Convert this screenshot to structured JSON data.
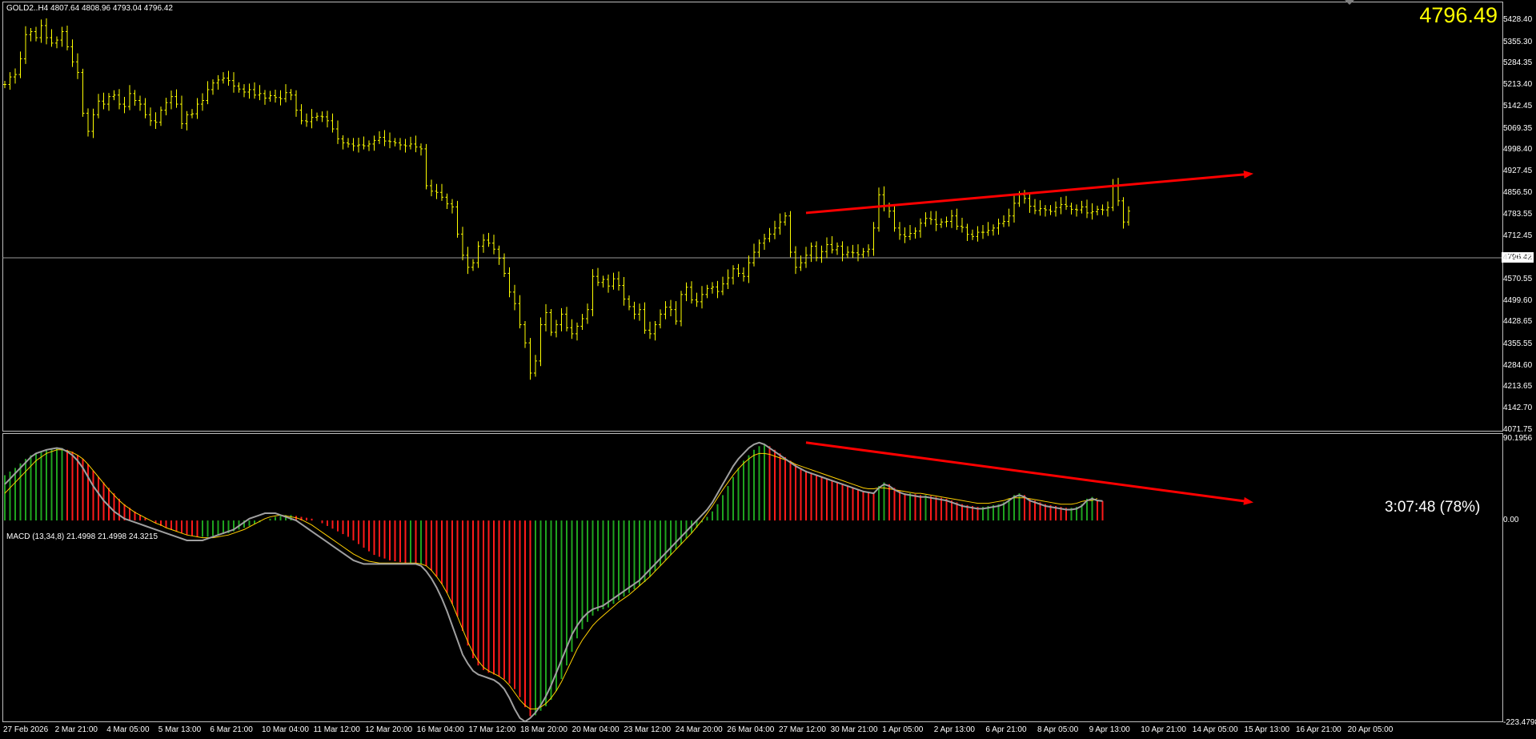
{
  "window": {
    "symbol_line": "GOLD2..H4  4807.64 4808.96 4793.04 4796.42",
    "bid_display": "4796.49",
    "current_price_box": "4796.42",
    "countdown": "3:07:48 (78%)"
  },
  "colors": {
    "background": "#000000",
    "candle": "#ffff00",
    "trendline": "#ff0000",
    "histogram_up": "#1fa41f",
    "histogram_down": "#ff1a1a",
    "macd_line": "#a0a0a0",
    "signal_line": "#ffd000"
  },
  "chart_data": [
    {
      "type": "bar",
      "title": "GOLD2..H4",
      "ylim": [
        4071.75,
        5470
      ],
      "y_ticks": [
        "5428.40",
        "5355.30",
        "5284.35",
        "5213.40",
        "5142.45",
        "5069.35",
        "4998.40",
        "4927.45",
        "4856.50",
        "4783.55",
        "4712.45",
        "4641.50",
        "4570.55",
        "4499.60",
        "4428.65",
        "4355.55",
        "4284.60",
        "4213.65",
        "4142.70",
        "4071.75"
      ],
      "x_tick_labels": [
        "27 Feb 2026",
        "2 Mar 21:00",
        "4 Mar 05:00",
        "5 Mar 13:00",
        "6 Mar 21:00",
        "10 Mar 04:00",
        "11 Mar 12:00",
        "12 Mar 20:00",
        "16 Mar 04:00",
        "17 Mar 12:00",
        "18 Mar 20:00",
        "20 Mar 04:00",
        "23 Mar 12:00",
        "24 Mar 20:00",
        "26 Mar 04:00",
        "27 Mar 12:00",
        "30 Mar 21:00",
        "1 Apr 05:00",
        "2 Apr 13:00",
        "6 Apr 21:00",
        "8 Apr 05:00",
        "9 Apr 13:00",
        "10 Apr 21:00",
        "14 Apr 05:00",
        "15 Apr 13:00",
        "16 Apr 21:00",
        "20 Apr 05:00"
      ],
      "series": [
        {
          "close": [
            5215,
            5240,
            5248,
            5300,
            5380,
            5390,
            5370,
            5410,
            5370,
            5352,
            5362,
            5390,
            5340,
            5290,
            5255,
            5120,
            5060,
            5115,
            5160,
            5150,
            5175,
            5180,
            5150,
            5142,
            5185,
            5162,
            5150,
            5115,
            5095,
            5090,
            5130,
            5155,
            5175,
            5150,
            5085,
            5115,
            5118,
            5150,
            5162,
            5198,
            5220,
            5230,
            5236,
            5228,
            5210,
            5200,
            5190,
            5198,
            5180,
            5185,
            5170,
            5178,
            5172,
            5168,
            5188,
            5180,
            5130,
            5095,
            5092,
            5106,
            5110,
            5108,
            5095,
            5068,
            5035,
            5022,
            5018,
            5012,
            5015,
            5012,
            5018,
            5030,
            5040,
            5028,
            5026,
            5022,
            5015,
            5012,
            5018,
            5008,
            5002,
            4880,
            4862,
            4858,
            4842,
            4820,
            4810,
            4720,
            4650,
            4610,
            4625,
            4680,
            4700,
            4690,
            4670,
            4640,
            4590,
            4528,
            4490,
            4420,
            4360,
            4260,
            4300,
            4420,
            4460,
            4395,
            4420,
            4455,
            4410,
            4390,
            4415,
            4440,
            4470,
            4580,
            4560,
            4570,
            4548,
            4572,
            4550,
            4505,
            4480,
            4455,
            4470,
            4402,
            4390,
            4420,
            4455,
            4478,
            4470,
            4432,
            4520,
            4544,
            4502,
            4496,
            4520,
            4540,
            4545,
            4530,
            4555,
            4575,
            4605,
            4590,
            4580,
            4625,
            4660,
            4690,
            4705,
            4720,
            4740,
            4760,
            4780,
            4660,
            4610,
            4625,
            4650,
            4680,
            4642,
            4662,
            4685,
            4668,
            4680,
            4652,
            4660,
            4658,
            4652,
            4662,
            4670,
            4740,
            4850,
            4812,
            4796,
            4740,
            4718,
            4712,
            4722,
            4730,
            4756,
            4772,
            4768,
            4752,
            4760,
            4762,
            4780,
            4746,
            4742,
            4719,
            4712,
            4726,
            4726,
            4732,
            4740,
            4755,
            4762,
            4780,
            4822,
            4850,
            4838,
            4812,
            4798,
            4804,
            4800,
            4795,
            4808,
            4818,
            4812,
            4802,
            4800,
            4810,
            4790,
            4794,
            4802,
            4800,
            4808,
            4878,
            4830,
            4760,
            4796
          ]
        }
      ]
    },
    {
      "type": "bar",
      "title": "MACD (13,34,8) 21.4998 21.4998 24.3215",
      "ylim": [
        -223.4798,
        90.1956
      ],
      "y_ticks": [
        "90.1956",
        "0.00",
        "-223.4798"
      ],
      "series": [
        {
          "name": "histogram",
          "values": [
            50,
            54,
            58,
            63,
            68,
            72,
            74,
            76,
            78,
            79,
            80,
            80,
            78,
            76,
            72,
            68,
            62,
            55,
            48,
            42,
            36,
            30,
            24,
            18,
            14,
            10,
            6,
            3,
            0,
            -3,
            -6,
            -8,
            -10,
            -12,
            -14,
            -16,
            -17,
            -18,
            -18,
            -18,
            -17,
            -16,
            -15,
            -14,
            -12,
            -10,
            -8,
            -6,
            -4,
            -2,
            0,
            2,
            4,
            5,
            6,
            6,
            5,
            4,
            3,
            2,
            0,
            -3,
            -6,
            -9,
            -12,
            -15,
            -18,
            -22,
            -26,
            -30,
            -34,
            -38,
            -40,
            -42,
            -44,
            -45,
            -46,
            -47,
            -47,
            -48,
            -48,
            -50,
            -55,
            -62,
            -70,
            -80,
            -92,
            -106,
            -122,
            -138,
            -152,
            -160,
            -165,
            -168,
            -170,
            -172,
            -175,
            -180,
            -186,
            -195,
            -206,
            -216,
            -215,
            -210,
            -205,
            -198,
            -188,
            -175,
            -160,
            -145,
            -130,
            -120,
            -112,
            -105,
            -100,
            -98,
            -96,
            -92,
            -88,
            -84,
            -80,
            -76,
            -72,
            -68,
            -62,
            -56,
            -50,
            -44,
            -38,
            -32,
            -26,
            -20,
            -14,
            -8,
            -2,
            4,
            10,
            18,
            28,
            38,
            48,
            58,
            66,
            72,
            78,
            82,
            84,
            82,
            78,
            74,
            70,
            66,
            62,
            58,
            55,
            52,
            50,
            48,
            46,
            44,
            42,
            40,
            38,
            36,
            34,
            32,
            31,
            30,
            38,
            42,
            40,
            36,
            33,
            30,
            30,
            29,
            28,
            28,
            27,
            26,
            25,
            24,
            22,
            20,
            18,
            17,
            16,
            15,
            15,
            16,
            17,
            18,
            20,
            24,
            28,
            30,
            28,
            24,
            22,
            20,
            18,
            17,
            16,
            15,
            14,
            14,
            15,
            18,
            24,
            26,
            22,
            21.4998
          ]
        },
        {
          "name": "macd",
          "values": [
            40,
            46,
            52,
            58,
            64,
            70,
            74,
            76,
            78,
            79,
            80,
            79,
            76,
            72,
            66,
            58,
            48,
            38,
            30,
            22,
            16,
            10,
            6,
            2,
            0,
            -2,
            -4,
            -6,
            -8,
            -10,
            -12,
            -14,
            -16,
            -18,
            -20,
            -22,
            -22,
            -22,
            -22,
            -20,
            -18,
            -16,
            -14,
            -12,
            -10,
            -6,
            -2,
            2,
            4,
            6,
            8,
            8,
            8,
            6,
            4,
            2,
            0,
            -4,
            -8,
            -12,
            -16,
            -20,
            -24,
            -28,
            -32,
            -36,
            -40,
            -44,
            -46,
            -48,
            -48,
            -48,
            -48,
            -48,
            -48,
            -48,
            -48,
            -48,
            -48,
            -48,
            -50,
            -56,
            -64,
            -74,
            -86,
            -100,
            -116,
            -132,
            -148,
            -158,
            -166,
            -170,
            -172,
            -174,
            -176,
            -180,
            -186,
            -196,
            -208,
            -218,
            -222,
            -218,
            -212,
            -204,
            -194,
            -182,
            -168,
            -154,
            -140,
            -126,
            -116,
            -108,
            -102,
            -98,
            -96,
            -94,
            -90,
            -86,
            -82,
            -78,
            -74,
            -70,
            -66,
            -60,
            -54,
            -48,
            -42,
            -36,
            -30,
            -24,
            -18,
            -12,
            -6,
            0,
            6,
            12,
            20,
            30,
            40,
            50,
            60,
            68,
            74,
            80,
            84,
            86,
            84,
            80,
            76,
            72,
            68,
            64,
            60,
            57,
            54,
            52,
            50,
            48,
            46,
            44,
            42,
            40,
            38,
            36,
            34,
            32,
            31,
            30,
            36,
            40,
            38,
            34,
            31,
            29,
            28,
            27,
            26,
            26,
            25,
            24,
            23,
            22,
            20,
            18,
            16,
            15,
            14,
            13,
            13,
            14,
            15,
            16,
            18,
            22,
            26,
            28,
            26,
            22,
            20,
            18,
            16,
            15,
            14,
            13,
            12,
            12,
            13,
            16,
            22,
            24,
            22,
            21.4998
          ]
        },
        {
          "name": "signal",
          "values": [
            30,
            36,
            42,
            48,
            54,
            60,
            66,
            70,
            74,
            76,
            78,
            78,
            77,
            75,
            72,
            68,
            62,
            55,
            48,
            41,
            34,
            28,
            22,
            17,
            13,
            9,
            6,
            3,
            0,
            -3,
            -5,
            -8,
            -10,
            -12,
            -14,
            -16,
            -17,
            -18,
            -19,
            -19,
            -19,
            -18,
            -17,
            -16,
            -14,
            -12,
            -10,
            -7,
            -4,
            -1,
            2,
            4,
            5,
            6,
            5,
            4,
            3,
            1,
            -2,
            -5,
            -9,
            -13,
            -17,
            -21,
            -25,
            -29,
            -33,
            -37,
            -40,
            -43,
            -45,
            -46,
            -47,
            -47,
            -47,
            -47,
            -47,
            -47,
            -47,
            -47,
            -48,
            -50,
            -55,
            -62,
            -70,
            -80,
            -92,
            -106,
            -120,
            -134,
            -146,
            -155,
            -162,
            -166,
            -169,
            -172,
            -176,
            -182,
            -190,
            -198,
            -204,
            -208,
            -208,
            -206,
            -202,
            -196,
            -188,
            -178,
            -166,
            -154,
            -142,
            -132,
            -124,
            -116,
            -110,
            -105,
            -100,
            -95,
            -90,
            -86,
            -82,
            -77,
            -72,
            -67,
            -62,
            -56,
            -50,
            -44,
            -38,
            -32,
            -26,
            -20,
            -14,
            -7,
            0,
            8,
            16,
            25,
            34,
            42,
            50,
            57,
            63,
            68,
            72,
            74,
            74,
            73,
            71,
            69,
            67,
            65,
            62,
            60,
            58,
            56,
            54,
            52,
            50,
            48,
            46,
            44,
            42,
            40,
            38,
            36,
            35,
            35,
            36,
            36,
            35,
            34,
            33,
            32,
            31,
            30,
            30,
            29,
            28,
            27,
            26,
            25,
            24,
            23,
            22,
            21,
            20,
            19,
            19,
            19,
            20,
            21,
            22,
            24,
            25,
            25,
            25,
            24,
            23,
            22,
            21,
            20,
            19,
            18,
            18,
            18,
            19,
            21,
            22,
            22,
            24.3215
          ]
        }
      ]
    }
  ],
  "trendlines": [
    {
      "pane": "price",
      "from_bar": 154,
      "from_value": 4790,
      "to_bar": 240,
      "to_value": 4920
    },
    {
      "pane": "macd",
      "from_bar": 154,
      "from_value": 86,
      "to_bar": 240,
      "to_value": 20
    }
  ]
}
